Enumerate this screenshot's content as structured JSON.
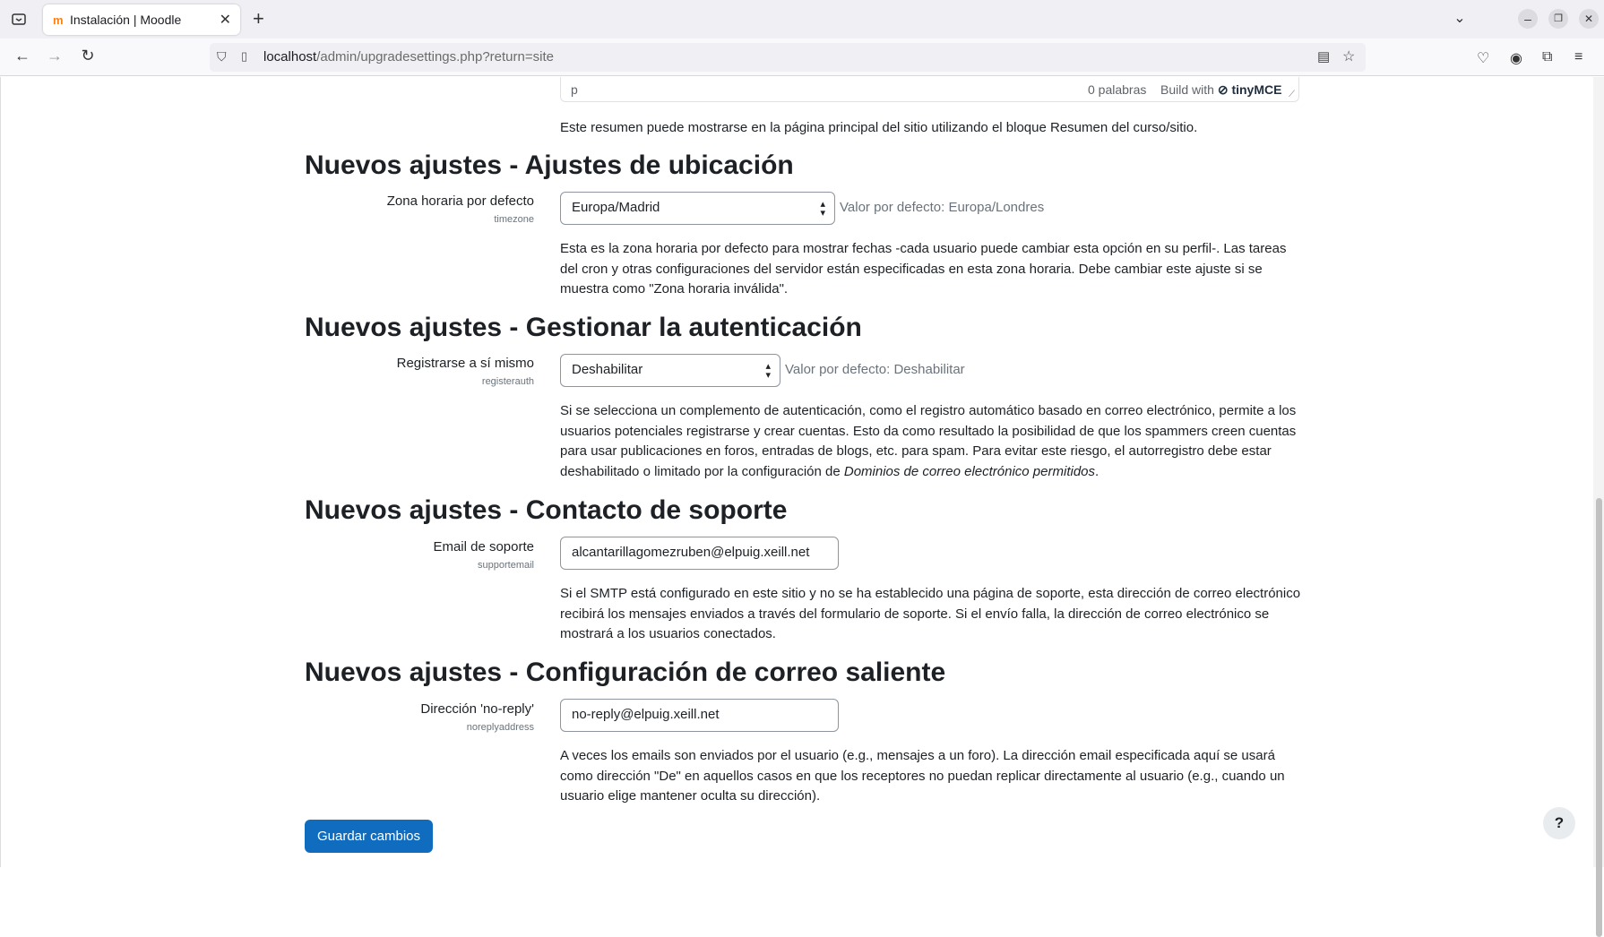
{
  "browser": {
    "tab_title": "Instalación | Moodle",
    "tab_favicon": "m",
    "url_host": "localhost",
    "url_path": "/admin/upgradesettings.php?return=site"
  },
  "editor_status": {
    "path": "p",
    "word_count": "0 palabras",
    "built_with": "Build with",
    "brand": "tinyMCE"
  },
  "summary_desc": "Este resumen puede mostrarse en la página principal del sitio utilizando el bloque Resumen del curso/sitio.",
  "sections": {
    "location": {
      "heading": "Nuevos ajustes - Ajustes de ubicación",
      "label": "Zona horaria por defecto",
      "key": "timezone",
      "value": "Europa/Madrid",
      "default": "Valor por defecto: Europa/Londres",
      "desc": "Esta es la zona horaria por defecto para mostrar fechas -cada usuario puede cambiar esta opción en su perfil-. Las tareas del cron y otras configuraciones del servidor están especificadas en esta zona horaria. Debe cambiar este ajuste si se muestra como \"Zona horaria inválida\"."
    },
    "auth": {
      "heading": "Nuevos ajustes - Gestionar la autenticación",
      "label": "Registrarse a sí mismo",
      "key": "registerauth",
      "value": "Deshabilitar",
      "default": "Valor por defecto: Deshabilitar",
      "desc_main": "Si se selecciona un complemento de autenticación, como el registro automático basado en correo electrónico, permite a los usuarios potenciales registrarse y crear cuentas. Esto da como resultado la posibilidad de que los spammers creen cuentas para usar publicaciones en foros, entradas de blogs, etc. para spam. Para evitar este riesgo, el autorregistro debe estar deshabilitado o limitado por la configuración de ",
      "desc_italic": "Dominios de correo electrónico permitidos",
      "desc_end": "."
    },
    "support": {
      "heading": "Nuevos ajustes - Contacto de soporte",
      "label": "Email de soporte",
      "key": "supportemail",
      "value": "alcantarillagomezruben@elpuig.xeill.net",
      "desc": "Si el SMTP está configurado en este sitio y no se ha establecido una página de soporte, esta dirección de correo electrónico recibirá los mensajes enviados a través del formulario de soporte. Si el envío falla, la dirección de correo electrónico se mostrará a los usuarios conectados."
    },
    "mail": {
      "heading": "Nuevos ajustes - Configuración de correo saliente",
      "label": "Dirección 'no-reply'",
      "key": "noreplyaddress",
      "value": "no-reply@elpuig.xeill.net",
      "desc": "A veces los emails son enviados por el usuario (e.g., mensajes a un foro). La dirección email especificada aquí se usará como dirección \"De\" en aquellos casos en que los receptores no puedan replicar directamente al usuario (e.g., cuando un usuario elige mantener oculta su dirección)."
    }
  },
  "save_label": "Guardar cambios",
  "help_label": "?"
}
